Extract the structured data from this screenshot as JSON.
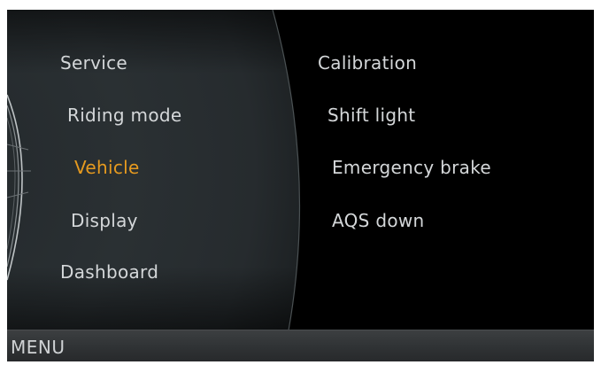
{
  "main_menu": {
    "items": [
      {
        "label": "Service"
      },
      {
        "label": "Riding mode"
      },
      {
        "label": "Vehicle",
        "active": true
      },
      {
        "label": "Display"
      },
      {
        "label": "Dashboard"
      }
    ]
  },
  "sub_menu": {
    "items": [
      {
        "label": "Calibration"
      },
      {
        "label": "Shift light"
      },
      {
        "label": "Emergency brake"
      },
      {
        "label": "AQS down"
      }
    ]
  },
  "footer": {
    "title": "MENU"
  },
  "colors": {
    "active": "#e69a1f",
    "text": "#d4d7d9",
    "background": "#000000"
  }
}
